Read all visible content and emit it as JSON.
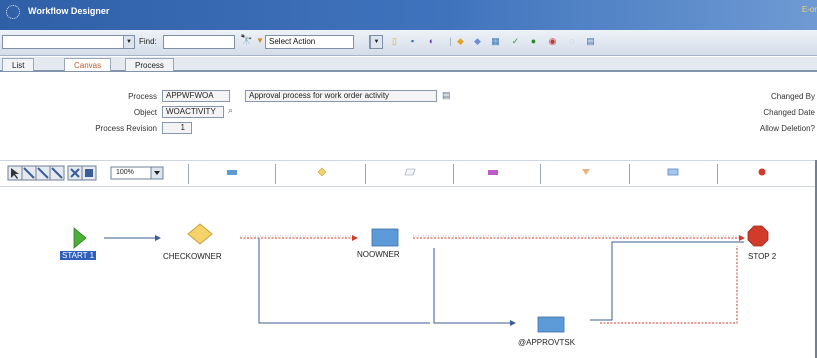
{
  "window": {
    "title": "Workflow Designer",
    "user_indicator": "E-or"
  },
  "toolbar": {
    "find_label": "Find:",
    "find_value": "",
    "left_combo_value": "",
    "action_select": "Select Action"
  },
  "tabs": [
    {
      "label": "List"
    },
    {
      "label": "Canvas"
    },
    {
      "label": "Process"
    }
  ],
  "form": {
    "process_label": "Process",
    "process_value": "APPWFWOA",
    "process_desc": "Approval process for work order activity",
    "object_label": "Object",
    "object_value": "WOACTIVITY",
    "revision_label": "Process Revision",
    "revision_value": "1",
    "changed_by_label": "Changed By",
    "changed_date_label": "Changed Date",
    "allow_deletion_label": "Allow Deletion?"
  },
  "palette": {
    "zoom_value": "100%",
    "items": [
      "task-node",
      "condition-node",
      "manual-input-node",
      "interaction-node",
      "wait-node",
      "subprocess-node",
      "stop-node"
    ]
  },
  "nodes": {
    "start": "START 1",
    "checkowner": "CHECKOWNER",
    "noowner": "NOOWNER",
    "approvtsk": "@APPROVTSK",
    "stop": "STOP 2"
  },
  "colors": {
    "title_bar": "#3f74bd",
    "start_node": "#4caf3a",
    "condition_node": "#f3d36a",
    "task_node": "#5d9bd8",
    "stop_node": "#d23a2a",
    "negative_path": "#d23a2a",
    "positive_path": "#4a6fa5"
  }
}
